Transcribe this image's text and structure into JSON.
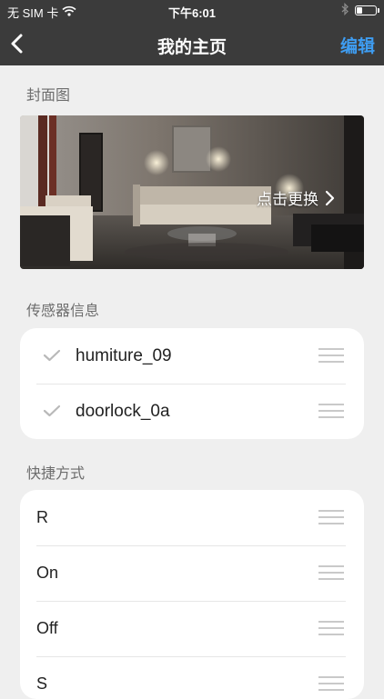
{
  "status_bar": {
    "carrier": "无 SIM 卡",
    "time": "下午6:01",
    "battery_level": 0.35
  },
  "nav": {
    "title": "我的主页",
    "edit_label": "编辑"
  },
  "cover": {
    "section_label": "封面图",
    "change_label": "点击更换"
  },
  "sensors": {
    "section_label": "传感器信息",
    "items": [
      {
        "label": "humiture_09"
      },
      {
        "label": "doorlock_0a"
      }
    ]
  },
  "shortcuts": {
    "section_label": "快捷方式",
    "items": [
      {
        "label": "R"
      },
      {
        "label": "On"
      },
      {
        "label": "Off"
      },
      {
        "label": "S"
      }
    ]
  },
  "colors": {
    "accent": "#3e9df2",
    "bar": "#3b3b3b",
    "background": "#efefef"
  }
}
